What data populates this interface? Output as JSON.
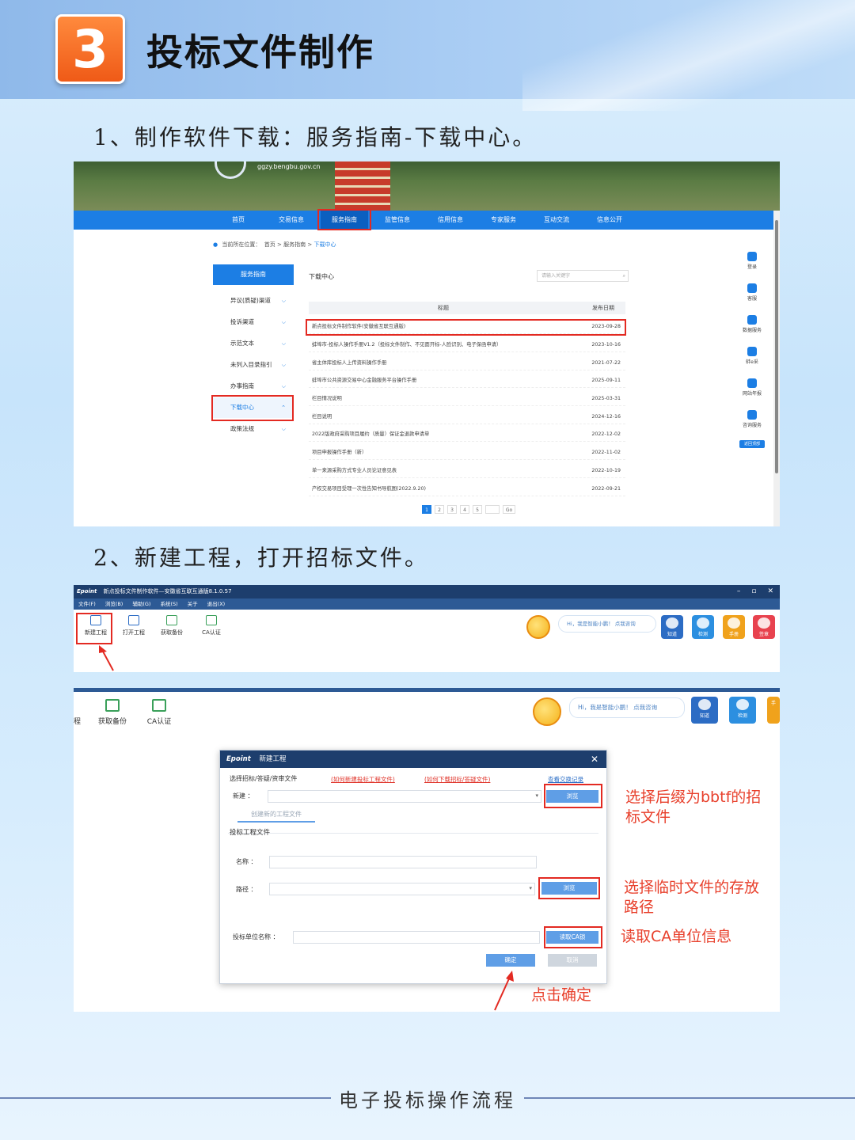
{
  "header": {
    "badge_number": "3",
    "title": "投标文件制作"
  },
  "steps": [
    "1、制作软件下载：服务指南-下载中心。",
    "2、新建工程，打开招标文件。"
  ],
  "website": {
    "url": "ggzy.bengbu.gov.cn",
    "nav": [
      "首页",
      "交易信息",
      "服务指南",
      "监管信息",
      "信用信息",
      "专家服务",
      "互动交流",
      "信息公开"
    ],
    "nav_active": "服务指南",
    "breadcrumb": {
      "prefix": "当前所在位置：",
      "home": "首页",
      "section": "服务指南",
      "current": "下载中心"
    },
    "sidebar_title": "服务指南",
    "sidebar_items": [
      "异议(质疑)渠道",
      "投诉渠道",
      "示范文本",
      "未列入目录指引",
      "办事指南",
      "下载中心",
      "政策法规"
    ],
    "content_title": "下载中心",
    "search_placeholder": "请输入关键字",
    "table_headers": {
      "title": "标题",
      "date": "发布日期"
    },
    "rows": [
      {
        "title": "新点投标文件制作软件(安徽省互联互通版)",
        "date": "2023-09-28"
      },
      {
        "title": "蚌埠市-投标人操作手册V1.2（投标文件制作、不见面开标-人脸识别、电子保函申请）",
        "date": "2023-10-16"
      },
      {
        "title": "省主体库投标人上传资料操作手册",
        "date": "2021-07-22"
      },
      {
        "title": "蚌埠市公共资源交易中心金融服务平台操作手册",
        "date": "2025-09-11"
      },
      {
        "title": "栏目情况说明",
        "date": "2025-03-31"
      },
      {
        "title": "栏目说明",
        "date": "2024-12-16"
      },
      {
        "title": "2022版政府采购项目履约（质量）保证金退款申请单",
        "date": "2022-12-02"
      },
      {
        "title": "项目申报操作手册（新）",
        "date": "2022-11-02"
      },
      {
        "title": "单一来源采购方式专业人员论证意见表",
        "date": "2022-10-19"
      },
      {
        "title": "产权交易项目受理一次性告知书导航图(2022.9.20)",
        "date": "2022-09-21"
      }
    ],
    "pager": [
      "1",
      "2",
      "3",
      "4",
      "5"
    ],
    "pager_go": "Go",
    "float_bar": [
      "登录",
      "客服",
      "数据服务",
      "蚌e采",
      "网站年报",
      "咨询服务"
    ],
    "float_btn": "返回顶部"
  },
  "software": {
    "brand": "Epoint",
    "window_title": "新点投标文件制作软件—安徽省互联互通版8.1.0.57",
    "window_controls": [
      "–",
      "▫",
      "✕"
    ],
    "menu": [
      "文件(F)",
      "浏览(B)",
      "辅助(G)",
      "系统(S)",
      "关于",
      "退出(X)"
    ],
    "toolbar": [
      "新建工程",
      "打开工程",
      "获取备份",
      "CA认证"
    ],
    "toolbar_partial": [
      "程",
      "获取备份",
      "CA认证"
    ],
    "assistant_text": "Hi，我是智能小鹏！",
    "assistant_link": "点我咨询",
    "apps": [
      "知道",
      "检测",
      "手册",
      "签章"
    ],
    "apps_partial": [
      "知道",
      "检测",
      "手"
    ]
  },
  "dialog": {
    "brand": "Epoint",
    "title": "新建工程",
    "label_select": "选择招标/答疑/资审文件",
    "link_new": "(如何新建投标工程文件)",
    "link_download": "(如何下载招标/答疑文件)",
    "link_view": "查看交换记录",
    "label_new": "新建 ：",
    "tab_create": "创建新的工程文件",
    "section_project": "投标工程文件",
    "label_name": "名称 ：",
    "label_path": "路径 ：",
    "label_unit": "投标单位名称 ：",
    "btn_browse": "浏览",
    "btn_read_ca": "读取CA锁",
    "btn_ok": "确定",
    "btn_cancel": "取消"
  },
  "annotations": {
    "a1": "选择后缀为bbtf的招标文件",
    "a2": "选择临时文件的存放路径",
    "a3": "读取CA单位信息",
    "a4": "点击确定"
  },
  "footer": {
    "text": "电子投标操作流程"
  },
  "colors": {
    "accent": "#1c7ee4",
    "highlight": "#e32a22",
    "badge": "#ef5a17",
    "window_bar": "#1d3e6d"
  }
}
